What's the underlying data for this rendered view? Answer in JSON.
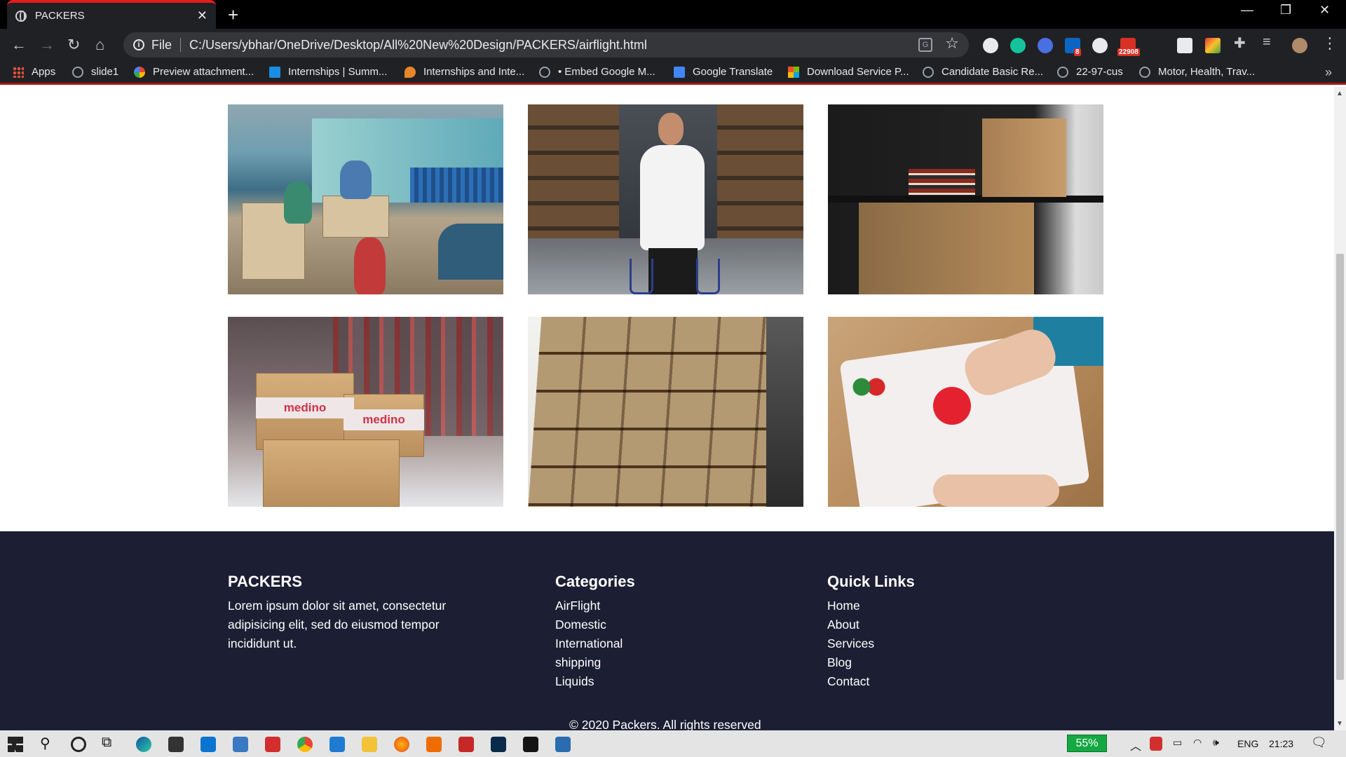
{
  "browser": {
    "tab_title": "PACKERS",
    "scheme_label": "File",
    "url": "C:/Users/ybhar/OneDrive/Desktop/All%20New%20Design/PACKERS/airflight.html",
    "extension_badges": {
      "linkedin": "8",
      "mail": "22908"
    }
  },
  "bookmarks": [
    {
      "label": "Apps",
      "icon": "apps-grid-icon",
      "color": "#e0503d"
    },
    {
      "label": "slide1",
      "icon": "globe-icon",
      "color": "#9aa0a6"
    },
    {
      "label": "Preview attachment...",
      "icon": "google-icon",
      "color": "#4285f4"
    },
    {
      "label": "Internships | Summ...",
      "icon": "internshala-icon",
      "color": "#1c8ce3"
    },
    {
      "label": "Internships and Inte...",
      "icon": "fire-icon",
      "color": "#e5862a"
    },
    {
      "label": "• Embed Google M...",
      "icon": "globe-icon",
      "color": "#9aa0a6"
    },
    {
      "label": "Google Translate",
      "icon": "translate-icon",
      "color": "#4285f4"
    },
    {
      "label": "Download Service P...",
      "icon": "microsoft-icon",
      "color": "#f25022"
    },
    {
      "label": "Candidate Basic Re...",
      "icon": "globe-icon",
      "color": "#9aa0a6"
    },
    {
      "label": "22-97-cus",
      "icon": "globe-icon",
      "color": "#9aa0a6"
    },
    {
      "label": "Motor, Health, Trav...",
      "icon": "globe-icon",
      "color": "#9aa0a6"
    }
  ],
  "gallery": {
    "photo_texts": {
      "medino_1": "medino",
      "medino_2": "medino"
    }
  },
  "footer": {
    "brand": {
      "title": "PACKERS",
      "text": "Lorem ipsum dolor sit amet, consectetur adipisicing elit, sed do eiusmod tempor incididunt ut."
    },
    "categories": {
      "title": "Categories",
      "items": [
        "AirFlight",
        "Domestic",
        "International",
        "shipping",
        "Liquids"
      ]
    },
    "quick_links": {
      "title": "Quick Links",
      "items": [
        "Home",
        "About",
        "Services",
        "Blog",
        "Contact"
      ]
    },
    "copyright": "© 2020 Packers. All rights reserved"
  },
  "taskbar": {
    "battery": "55%",
    "language": "ENG",
    "time": "21:23"
  },
  "colors": {
    "footer_bg": "#1c1f33",
    "tab_accent": "#e11d1d",
    "battery_green": "#14a843"
  }
}
